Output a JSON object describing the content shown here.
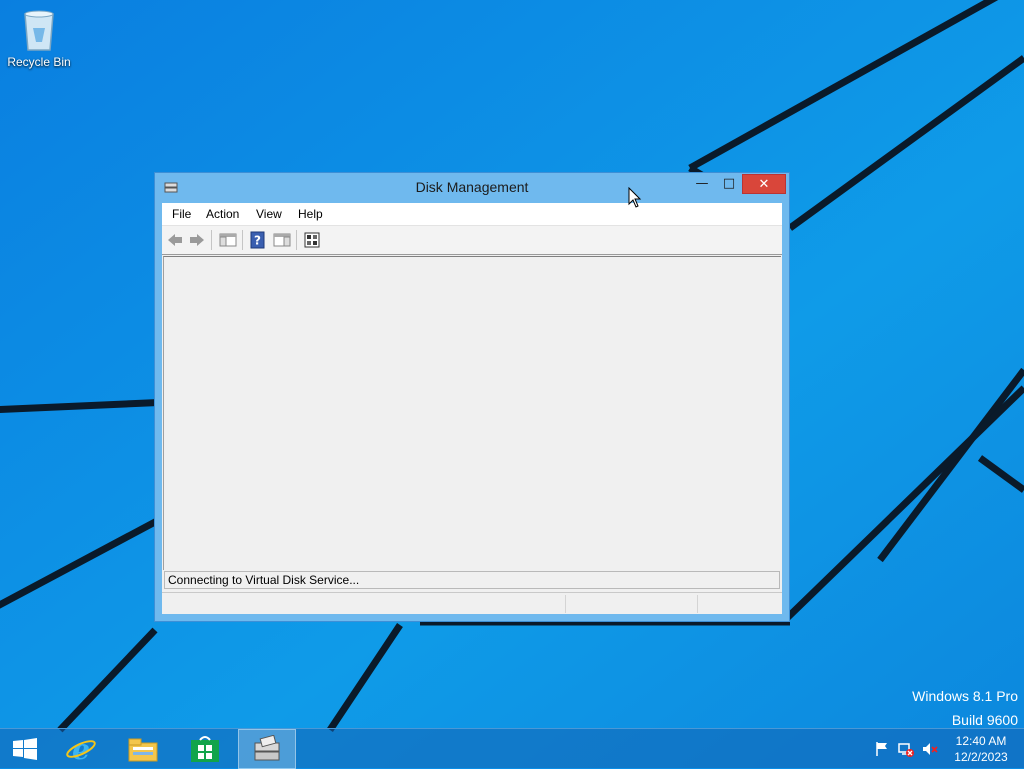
{
  "desktop": {
    "recycle_bin_label": "Recycle Bin",
    "watermark_line1": "Windows 8.1 Pro",
    "watermark_line2": "Build 9600"
  },
  "window": {
    "title": "Disk Management",
    "icon": "disk-management-icon",
    "controls": {
      "minimize": "minimize-icon",
      "maximize": "maximize-icon",
      "close": "close-icon"
    },
    "menu": [
      "File",
      "Action",
      "View",
      "Help"
    ],
    "toolbar": [
      "back-arrow-icon",
      "forward-arrow-icon",
      "show-hide-console-tree-icon",
      "help-icon",
      "show-hide-action-pane-icon",
      "properties-icon"
    ],
    "status_text": "Connecting to Virtual Disk Service..."
  },
  "taskbar": {
    "apps": [
      "start-icon",
      "internet-explorer-icon",
      "file-explorer-icon",
      "store-icon",
      "disk-management-taskbar-icon"
    ],
    "tray": [
      "action-center-flag-icon",
      "network-disconnected-icon",
      "volume-muted-icon"
    ],
    "clock": {
      "time": "12:40 AM",
      "date": "12/2/2023"
    }
  },
  "colors": {
    "desktop_blue": "#0a8de6",
    "window_frame": "#6fb9ee",
    "close_red": "#d9463a"
  }
}
